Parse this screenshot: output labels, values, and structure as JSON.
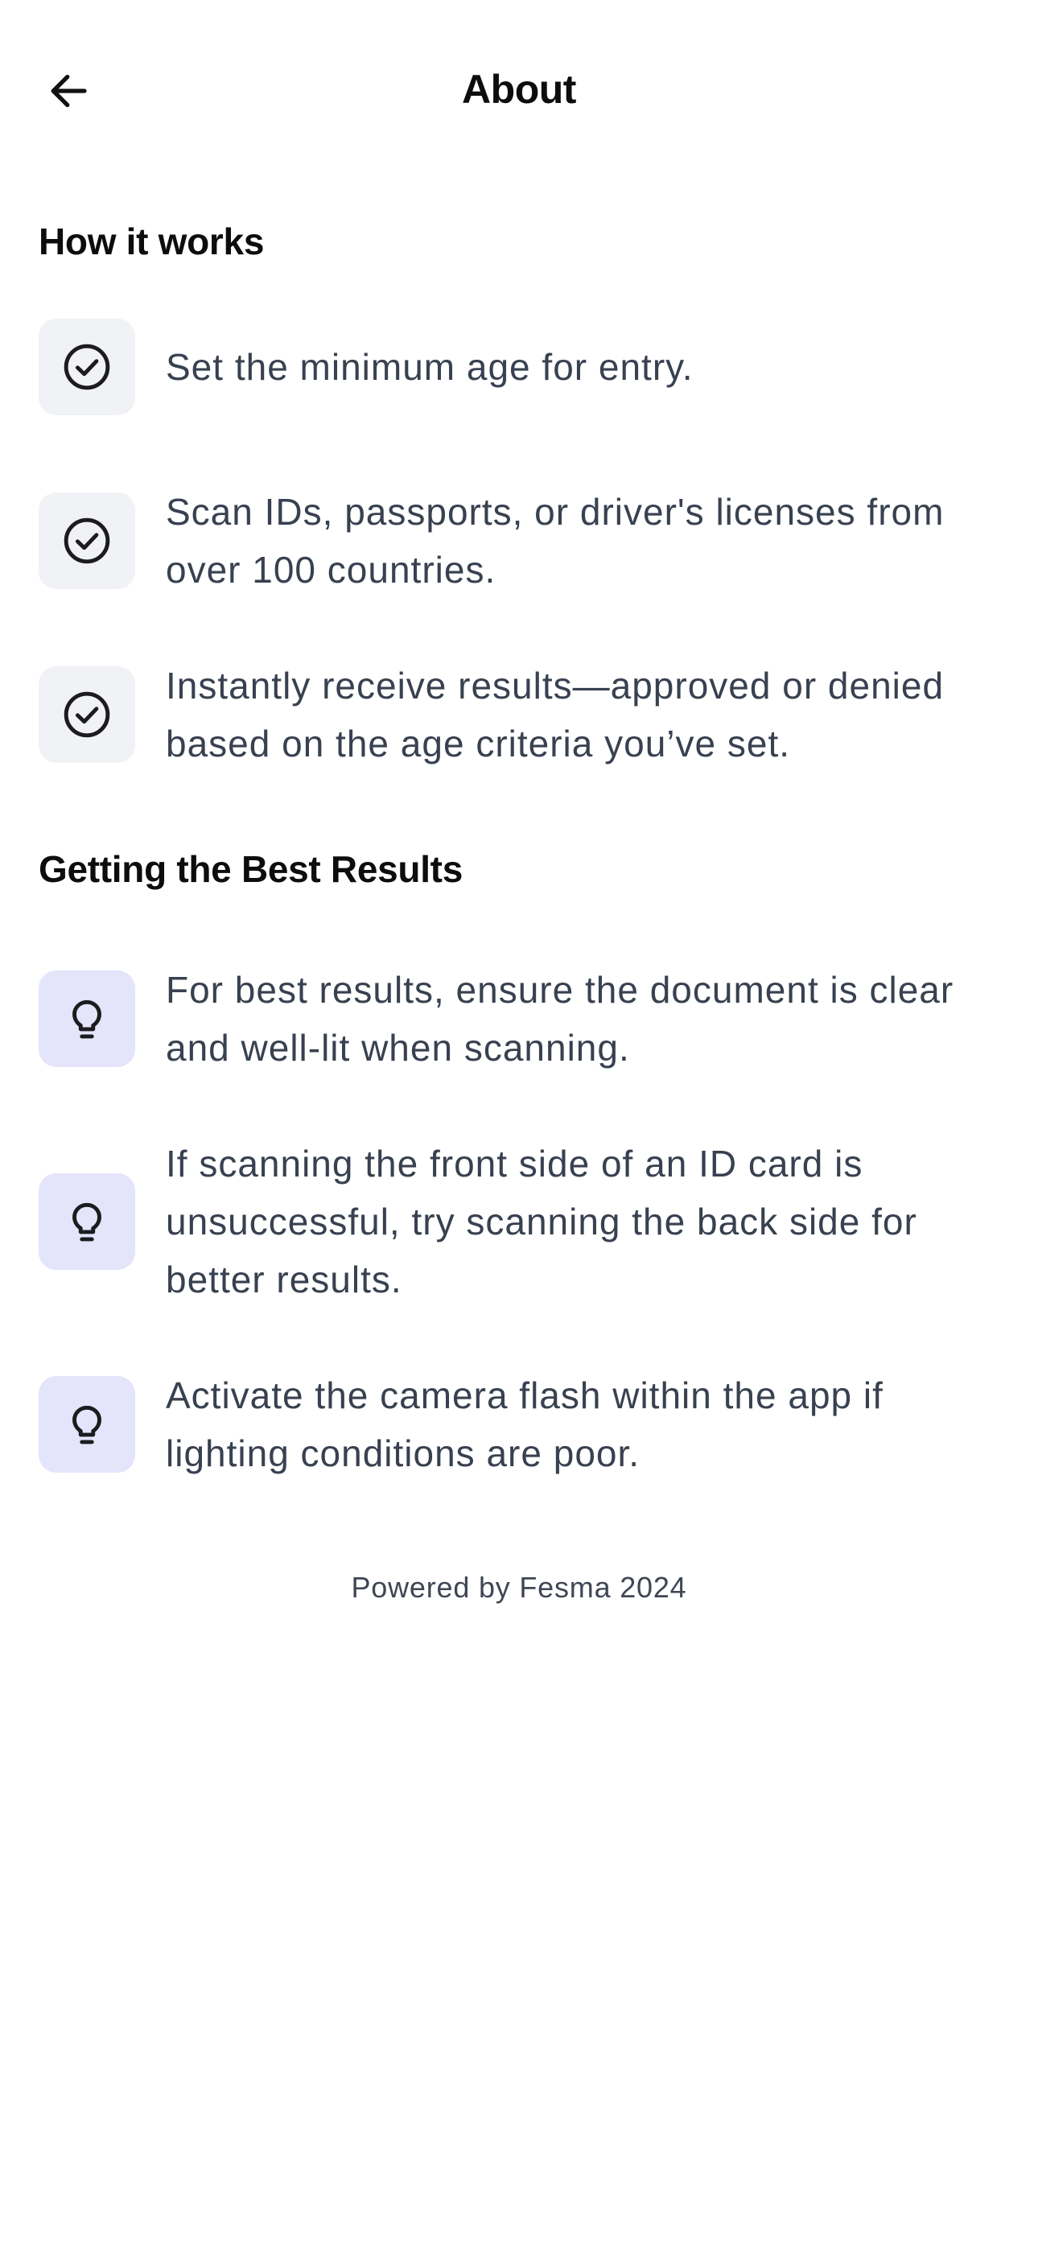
{
  "header": {
    "back_icon": "arrow-left-icon",
    "title": "About"
  },
  "how_it_works": {
    "heading": "How it works",
    "icon": "check-circle-icon",
    "icon_bg": "#f1f2f5",
    "items": [
      {
        "text": "Set the minimum age for entry."
      },
      {
        "text": "Scan IDs, passports, or driver's licenses from over 100 countries."
      },
      {
        "text": "Instantly receive results—approved or denied based on the age criteria you’ve set."
      }
    ]
  },
  "best_results": {
    "heading": "Getting the Best Results",
    "icon": "lightbulb-icon",
    "icon_bg": "#e4e4fb",
    "items": [
      {
        "text": "For best results, ensure the document is clear and well-lit when scanning."
      },
      {
        "text": "If scanning the front side of an ID card is unsuccessful, try scanning the back side for better results."
      },
      {
        "text": "Activate the camera flash within the app if lighting conditions are poor."
      }
    ]
  },
  "footer": {
    "text": "Powered by Fesma 2024"
  }
}
